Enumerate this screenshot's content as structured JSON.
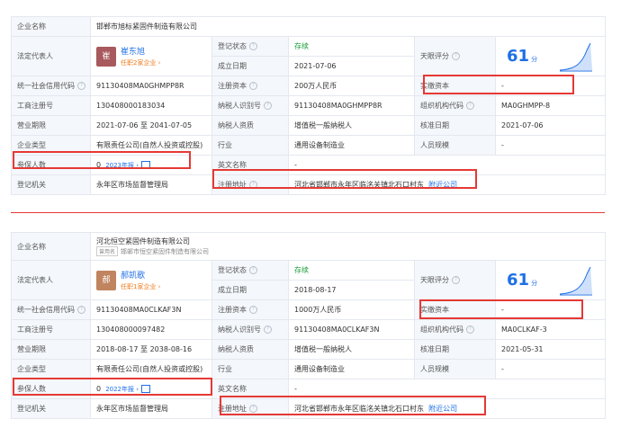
{
  "labels": {
    "company_name": "企业名称",
    "legal_rep": "法定代表人",
    "reg_status": "登记状态",
    "est_date": "成立日期",
    "credit_code": "统一社会信用代码",
    "reg_capital": "注册资本",
    "paid_capital": "实缴资本",
    "biz_reg_no": "工商注册号",
    "taxpayer_id": "纳税人识别号",
    "org_code": "组织机构代码",
    "biz_term": "营业期限",
    "taxpayer_qual": "纳税人资质",
    "approval_date": "核准日期",
    "company_type": "企业类型",
    "industry": "行业",
    "staff_size": "人员规模",
    "insured": "参保人数",
    "english_name": "英文名称",
    "reg_authority": "登记机关",
    "reg_address": "注册地址",
    "tianyan_score": "天眼评分",
    "score_unit": "分",
    "nearby": "附近公司",
    "former_name_tag": "曾用名"
  },
  "records": [
    {
      "company_name": "邯郸市旭标紧固件制造有限公司",
      "former_name": "",
      "legal_rep": "崔东旭",
      "avatar_char": "崔",
      "rep_companies": "任职2家企业 ›",
      "reg_status": "存续",
      "est_date": "2021-07-06",
      "score": "61",
      "credit_code": "91130408MA0GHMPP8R",
      "reg_capital": "200万人民币",
      "paid_capital": "-",
      "biz_reg_no": "130408000183034",
      "taxpayer_id": "91130408MA0GHMPP8R",
      "org_code": "MA0GHMPP-8",
      "biz_term": "2021-07-06 至 2041-07-05",
      "taxpayer_qual": "增值税一般纳税人",
      "approval_date": "2021-07-06",
      "company_type": "有限责任公司(自然人投资或控股)",
      "industry": "通用设备制造业",
      "staff_size": "-",
      "insured": "0",
      "insured_year": "2023年报 ›",
      "english_name": "-",
      "reg_authority": "永年区市场监督管理局",
      "reg_address": "河北省邯郸市永年区临洺关镇北石口村东"
    },
    {
      "company_name": "河北恒空紧固件制造有限公司",
      "former_name": "邯郸市恒空紧固件制造有限公司",
      "legal_rep": "郝凯歌",
      "avatar_char": "郝",
      "rep_companies": "任职1家企业 ›",
      "reg_status": "存续",
      "est_date": "2018-08-17",
      "score": "61",
      "credit_code": "91130408MA0CLKAF3N",
      "reg_capital": "1000万人民币",
      "paid_capital": "-",
      "biz_reg_no": "130408000097482",
      "taxpayer_id": "91130408MA0CLKAF3N",
      "org_code": "MA0CLKAF-3",
      "biz_term": "2018-08-17 至 2038-08-16",
      "taxpayer_qual": "增值税一般纳税人",
      "approval_date": "2021-05-31",
      "company_type": "有限责任公司(自然人投资或控股)",
      "industry": "通用设备制造业",
      "staff_size": "-",
      "insured": "0",
      "insured_year": "2022年报 ›",
      "english_name": "-",
      "reg_authority": "永年区市场监督管理局",
      "reg_address": "河北省邯郸市永年区临洺关镇北石口村东"
    }
  ]
}
